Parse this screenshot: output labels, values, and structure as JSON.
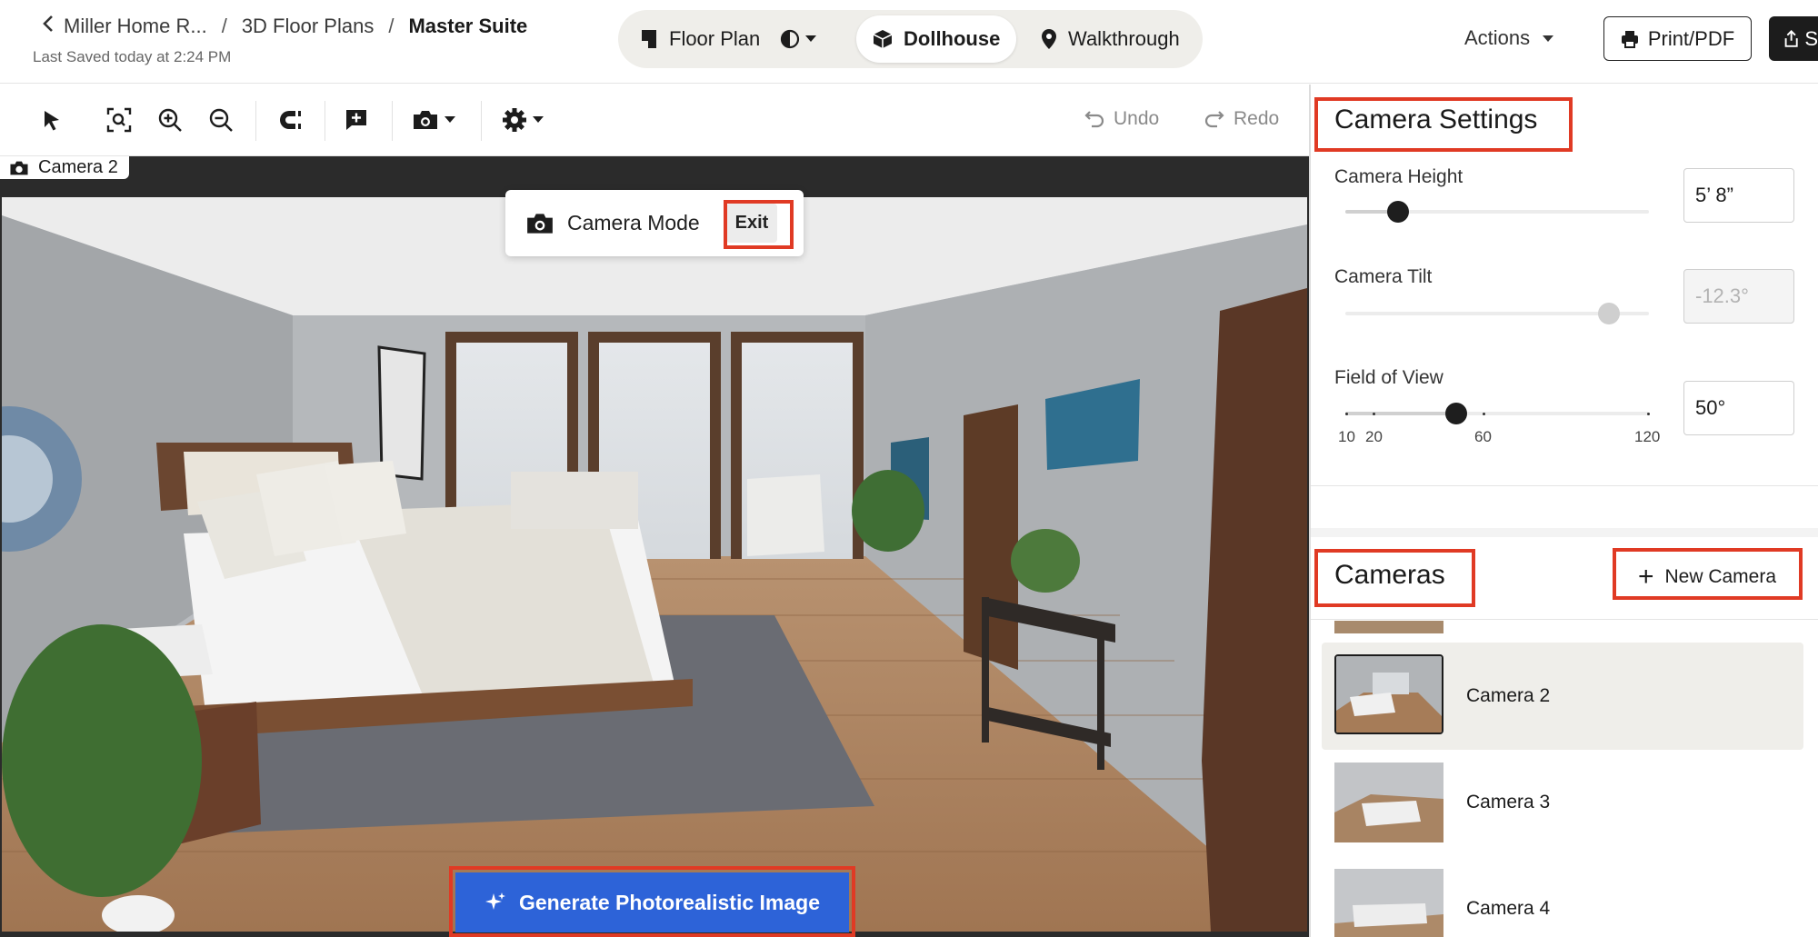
{
  "breadcrumb": {
    "items": [
      "Miller Home R...",
      "3D Floor Plans"
    ],
    "current": "Master Suite",
    "separator": "/"
  },
  "last_saved": "Last Saved today at 2:24 PM",
  "view_modes": {
    "floor_plan": "Floor Plan",
    "dollhouse": "Dollhouse",
    "walkthrough": "Walkthrough",
    "active": "Dollhouse"
  },
  "header": {
    "actions_label": "Actions",
    "print_label": "Print/PDF",
    "share_label": "S"
  },
  "toolbar": {
    "undo_label": "Undo",
    "redo_label": "Redo",
    "tools": [
      "select-icon",
      "fit-view-icon",
      "zoom-in-icon",
      "zoom-out-icon",
      "magnet-icon",
      "add-comment-icon",
      "camera-icon",
      "gear-icon"
    ]
  },
  "viewport": {
    "camera_tag": "Camera 2",
    "camera_mode_label": "Camera Mode",
    "exit_label": "Exit",
    "generate_label": "Generate Photorealistic Image"
  },
  "camera_settings": {
    "title": "Camera Settings",
    "height": {
      "label": "Camera Height",
      "value": "5’ 8”"
    },
    "tilt": {
      "label": "Camera Tilt",
      "value": "-12.3°"
    },
    "fov": {
      "label": "Field of View",
      "value": "50°",
      "ticks": [
        "10",
        "20",
        "60",
        "120"
      ]
    }
  },
  "cameras": {
    "title": "Cameras",
    "new_camera_label": "New Camera",
    "items": [
      {
        "name": "Camera 2",
        "selected": true
      },
      {
        "name": "Camera 3",
        "selected": false
      },
      {
        "name": "Camera 4",
        "selected": false
      }
    ]
  },
  "colors": {
    "accent_blue": "#2d63d8",
    "highlight_red": "#e03a24",
    "segmented_bg": "#efeeea"
  }
}
